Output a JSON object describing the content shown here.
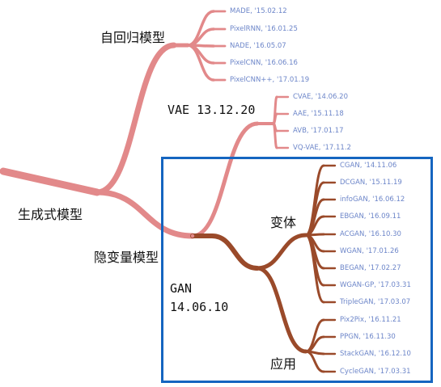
{
  "colors": {
    "pink": "#e2898a",
    "brown": "#9a4a2a",
    "box": "#1565c0",
    "leaf_text": "#6d86c9"
  },
  "labels": {
    "root": "生成式模型",
    "autoregressive": "自回归模型",
    "latent": "隐变量模型",
    "vae": "VAE  13.12.20",
    "gan_line1": "GAN",
    "gan_line2": "14.06.10",
    "variants": "变体",
    "applications": "应用"
  },
  "leaves": {
    "autoregressive": [
      "MADE, '15.02.12",
      "PixelRNN, '16.01.25",
      "NADE, '16.05.07",
      "PixelCNN, '16.06.16",
      "PixelCNN++, '17.01.19"
    ],
    "vae": [
      "CVAE, '14.06.20",
      "AAE, '15.11.18",
      "AVB, '17.01.17",
      "VQ-VAE, '17.11.2"
    ],
    "gan_variants": [
      "CGAN, '14.11.06",
      "DCGAN, '15.11.19",
      "infoGAN, '16.06.12",
      "EBGAN, '16.09.11",
      "ACGAN, '16.10.30",
      "WGAN, '17.01.26",
      "BEGAN, '17.02.27",
      "WGAN-GP, '17.03.31",
      "TripleGAN, '17.03.07"
    ],
    "gan_applications": [
      "Pix2Pix, '16.11.21",
      "PPGN, '16.11.30",
      "StackGAN, '16.12.10",
      "CycleGAN, '17.03.31"
    ]
  }
}
